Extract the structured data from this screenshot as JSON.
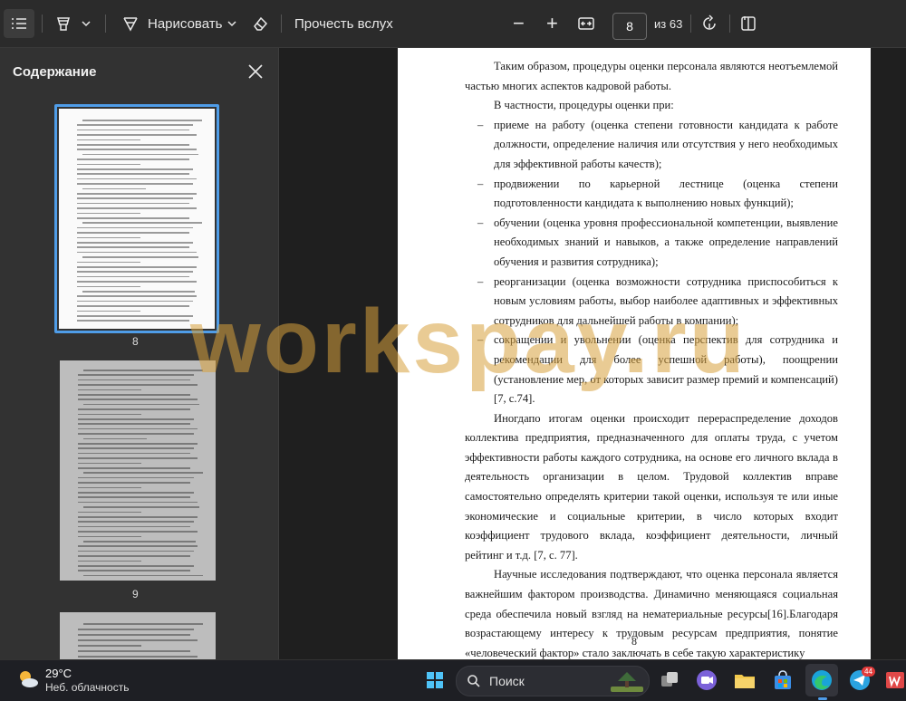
{
  "toolbar": {
    "draw_label": "Нарисовать",
    "read_aloud_label": "Прочесть вслух",
    "zoom_out": "−",
    "zoom_in": "+",
    "current_page": "8",
    "page_total": "из 63"
  },
  "sidebar": {
    "title": "Содержание",
    "thumbnails": [
      {
        "page": "8",
        "selected": true
      },
      {
        "page": "9",
        "selected": false
      }
    ]
  },
  "document": {
    "page_number": "8",
    "blocks": [
      {
        "type": "p",
        "text": "Таким образом, процедуры оценки персонала являются неотъемлемой частью многих аспектов кадровой работы."
      },
      {
        "type": "p",
        "text": "В частности, процедуры оценки при:"
      },
      {
        "type": "li",
        "text": "приеме на работу (оценка степени готовности кандидата к работе должности, определение наличия или отсутствия у него необходимых для эффективной работы качеств);"
      },
      {
        "type": "li",
        "text": "продвижении по карьерной лестнице (оценка степени подготовленности кандидата к выполнению новых функций);"
      },
      {
        "type": "li",
        "text": "обучении (оценка уровня профессиональной компетенции, выявление необходимых знаний и навыков, а также определение направлений обучения и развития сотрудника);"
      },
      {
        "type": "li",
        "text": "реорганизации (оценка возможности сотрудника приспособиться к новым условиям работы, выбор наиболее адаптивных и эффективных сотрудников для дальнейшей работы в компании);"
      },
      {
        "type": "li",
        "text": "сокращении и увольнении (оценка перспектив для сотрудника и рекомендации для более успешной работы), поощрении (установление мер, от которых зависит размер премий и компенсаций) [7, с.74]."
      },
      {
        "type": "p",
        "text": "Иногдапо итогам оценки происходит перераспределение доходов коллектива предприятия, предназначенного для оплаты труда, с учетом эффективности работы каждого сотрудника, на основе его личного вклада в деятельность организации в целом. Трудовой коллектив вправе самостоятельно определять критерии такой оценки, используя те или иные экономические и социальные критерии, в число которых входит коэффициент трудового вклада, коэффициент деятельности, личный рейтинг и т.д. [7, с. 77]."
      },
      {
        "type": "p",
        "text": "Научные исследования подтверждают, что оценка персонала является важнейшим фактором производства. Динамично меняющаяся социальная среда обеспечила новый взгляд на нематериальные ресурсы[16].Благодаря возрастающему интересу к трудовым ресурсам предприятия, понятие «человеческий фактор» стало заключать в себе такую характеристику"
      }
    ]
  },
  "watermark": "workspay.ru",
  "taskbar": {
    "temperature": "29°C",
    "condition": "Неб. облачность",
    "search_label": "Поиск",
    "badge_count": "44"
  },
  "colors": {
    "accent": "#4f9de8",
    "toolbar_bg": "#2b2b2b",
    "sidebar_bg": "#323232",
    "viewer_bg": "#1f1f1f",
    "watermark": "#d7a03c"
  }
}
